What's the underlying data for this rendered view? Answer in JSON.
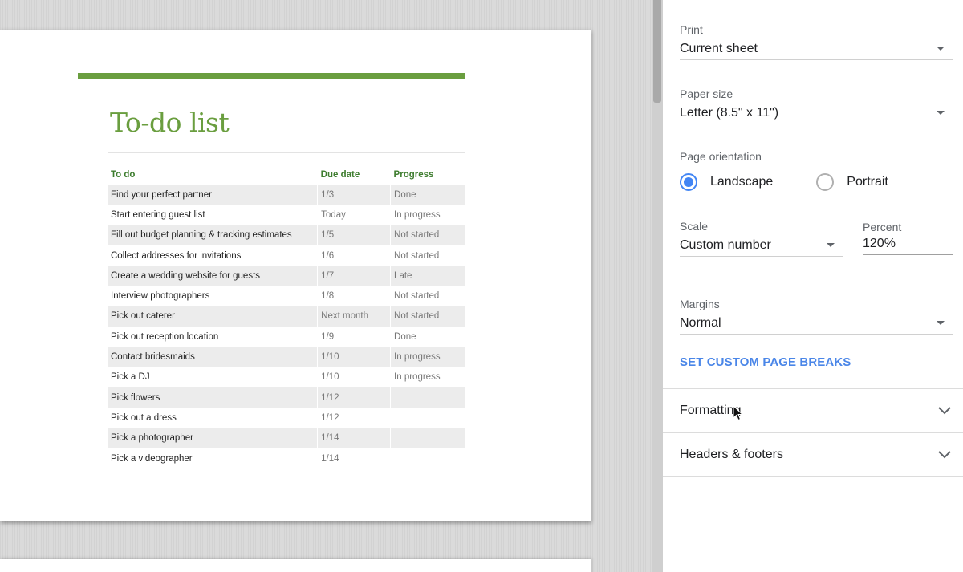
{
  "document": {
    "title": "To-do list",
    "columns": [
      "To do",
      "Due date",
      "Progress"
    ],
    "rows": [
      [
        "Find your perfect partner",
        "1/3",
        "Done"
      ],
      [
        "Start entering guest list",
        "Today",
        "In progress"
      ],
      [
        "Fill out budget planning & tracking estimates",
        "1/5",
        "Not started"
      ],
      [
        "Collect addresses for invitations",
        "1/6",
        "Not started"
      ],
      [
        "Create a wedding website for guests",
        "1/7",
        "Late"
      ],
      [
        "Interview photographers",
        "1/8",
        "Not started"
      ],
      [
        "Pick out caterer",
        "Next month",
        "Not started"
      ],
      [
        "Pick out reception location",
        "1/9",
        "Done"
      ],
      [
        "Contact bridesmaids",
        "1/10",
        "In progress"
      ],
      [
        "Pick a DJ",
        "1/10",
        "In progress"
      ],
      [
        "Pick flowers",
        "1/12",
        ""
      ],
      [
        "Pick out a dress",
        "1/12",
        ""
      ],
      [
        "Pick a photographer",
        "1/14",
        ""
      ],
      [
        "Pick a videographer",
        "1/14",
        ""
      ]
    ],
    "accent_color": "#6a9e3f"
  },
  "settings": {
    "print_label": "Print",
    "print_value": "Current sheet",
    "paper_size_label": "Paper size",
    "paper_size_value": "Letter (8.5\" x 11\")",
    "orientation_label": "Page orientation",
    "orientation_landscape": "Landscape",
    "orientation_portrait": "Portrait",
    "orientation_selected": "Landscape",
    "scale_label": "Scale",
    "scale_value": "Custom number",
    "percent_label": "Percent",
    "percent_value": "120%",
    "margins_label": "Margins",
    "margins_value": "Normal",
    "custom_breaks_label": "SET CUSTOM PAGE BREAKS",
    "formatting_label": "Formatting",
    "headers_footers_label": "Headers & footers",
    "accent_color": "#4285f4"
  },
  "icons": {
    "dropdown": "caret-down-icon",
    "expand": "chevron-down-icon",
    "cursor": "mouse-pointer-icon"
  }
}
